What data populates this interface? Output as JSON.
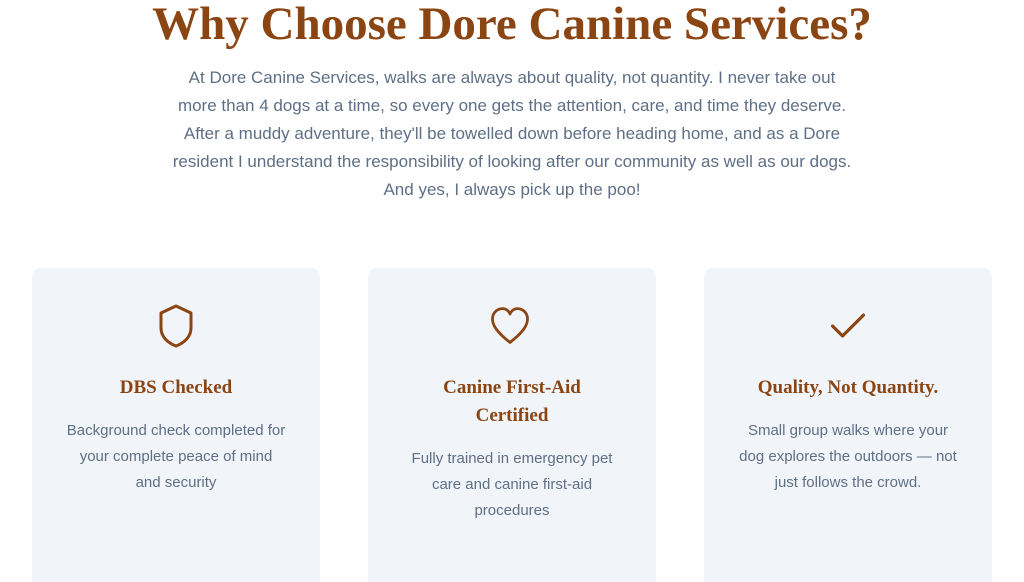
{
  "section": {
    "title": "Why Choose Dore Canine Services?",
    "intro": "At Dore Canine Services, walks are always about quality, not quantity. I never take out more than 4 dogs at a time, so every one gets the attention, care, and time they deserve. After a muddy adventure, they'll be towelled down before heading home, and as a Dore resident I understand the responsibility of looking after our community as well as our dogs. And yes, I always pick up the poo!"
  },
  "colors": {
    "accent": "#8b4513",
    "body_text": "#5f6f86",
    "card_background": "#f1f4f9"
  },
  "features": [
    {
      "icon": "shield-icon",
      "title": "DBS Checked",
      "description": "Background check completed for your complete peace of mind and security"
    },
    {
      "icon": "heart-icon",
      "title": "Canine First-Aid Certified",
      "description": "Fully trained in emergency pet care and canine first-aid procedures"
    },
    {
      "icon": "check-icon",
      "title": "Quality, Not Quantity.",
      "description": "Small group walks where your dog explores the outdoors — not just follows the crowd."
    }
  ]
}
